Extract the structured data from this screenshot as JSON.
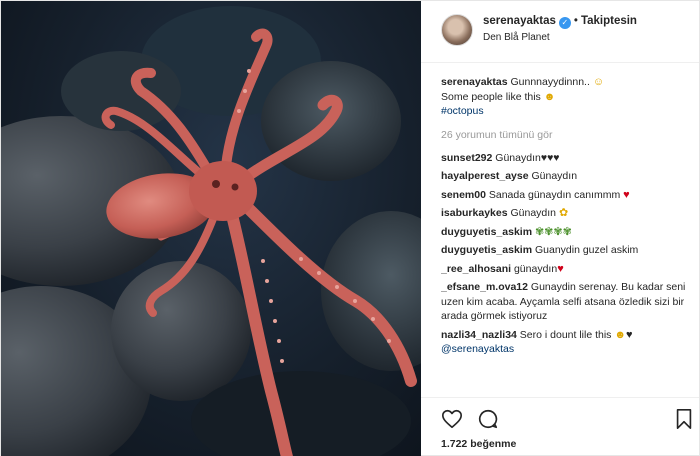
{
  "header": {
    "username": "serenayaktas",
    "follow_label": "Takiptesin",
    "location": "Den Blå Planet"
  },
  "caption": {
    "username": "serenayaktas",
    "line1": "Gunnnayydinnn..",
    "line2": "Some people like this",
    "hashtag": "#octopus"
  },
  "view_all_label": "26 yorumun tümünü gör",
  "comments": [
    {
      "user": "sunset292",
      "text": "Günaydın♥♥♥"
    },
    {
      "user": "hayalperest_ayse",
      "text": "Günaydın"
    },
    {
      "user": "senem00",
      "text": "Sanada günaydın canımmm"
    },
    {
      "user": "isaburkaykes",
      "text": "Günaydın"
    },
    {
      "user": "duyguyetis_askim",
      "text": ""
    },
    {
      "user": "duyguyetis_askim",
      "text": "Guanydin guzel askim"
    },
    {
      "user": "_ree_alhosani",
      "text": "günaydın"
    },
    {
      "user": "_efsane_m.ova12",
      "text": "Gunaydin serenay. Bu kadar seni uzen kim acaba. Ayçamla selfi atsana özledik sizi bir arada görmek istiyoruz"
    },
    {
      "user": "nazli34_nazli34",
      "text": "Sero i dount lile this"
    }
  ],
  "last_mention": "@serenayaktas",
  "likes_text": "1.722 beğenme",
  "icons": {
    "like": "heart-outline-icon",
    "comment": "speech-bubble-icon",
    "save": "bookmark-icon",
    "verified": "verified-badge-icon"
  },
  "colors": {
    "link": "#003569",
    "verified": "#3897f0",
    "muted": "#999999",
    "octopus": "#c9625a"
  }
}
